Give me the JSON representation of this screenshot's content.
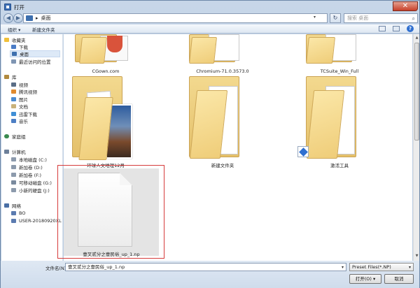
{
  "window": {
    "title": "打开",
    "close_symbol": "✕"
  },
  "nav": {
    "back_symbol": "◀",
    "forward_symbol": "▶",
    "breadcrumb_sep": "▸",
    "location": "桌面",
    "dropdown": "▾",
    "refresh_symbol": "↻",
    "search_placeholder": "搜索 桌面",
    "search_symbol": "⌕"
  },
  "toolbar": {
    "organize": "组织 ▾",
    "new_folder": "新建文件夹",
    "help": "?"
  },
  "sidebar": {
    "favorites": {
      "label": "收藏夹",
      "items": [
        "下载",
        "桌面",
        "最近访问的位置"
      ]
    },
    "libraries": {
      "label": "库",
      "items": [
        "视频",
        "腾讯视频",
        "图片",
        "文档",
        "迅雷下载",
        "音乐"
      ]
    },
    "homegroup": "家庭组",
    "computer": {
      "label": "计算机",
      "items": [
        "本地磁盘 (C:)",
        "新加卷 (D:)",
        "新加卷 (F:)",
        "可移动磁盘 (G:)",
        "小新的硬盘 (J:)"
      ]
    },
    "network": {
      "label": "网络",
      "items": [
        "BO",
        "USER-20180920XL"
      ]
    }
  },
  "files": [
    {
      "name": "CGown.com"
    },
    {
      "name": "Chromium-71.0.3573.0"
    },
    {
      "name": "TCSuite_Win_Full"
    },
    {
      "name": "环球人文地理12月"
    },
    {
      "name": "新建文件夹"
    },
    {
      "name": "激活工具"
    },
    {
      "name": "壹叉贰分之壹民俗_up_1.np"
    }
  ],
  "bottom": {
    "filename_label": "文件名(N):",
    "filename_value": "壹叉贰分之壹民俗_up_1.np",
    "filter": "Preset Files(*.NP)",
    "open": "打开(O)",
    "open_dd": "▾",
    "cancel": "取消"
  },
  "colors": {
    "selection_border": "#d63b3b",
    "folder": "#efcd79"
  }
}
